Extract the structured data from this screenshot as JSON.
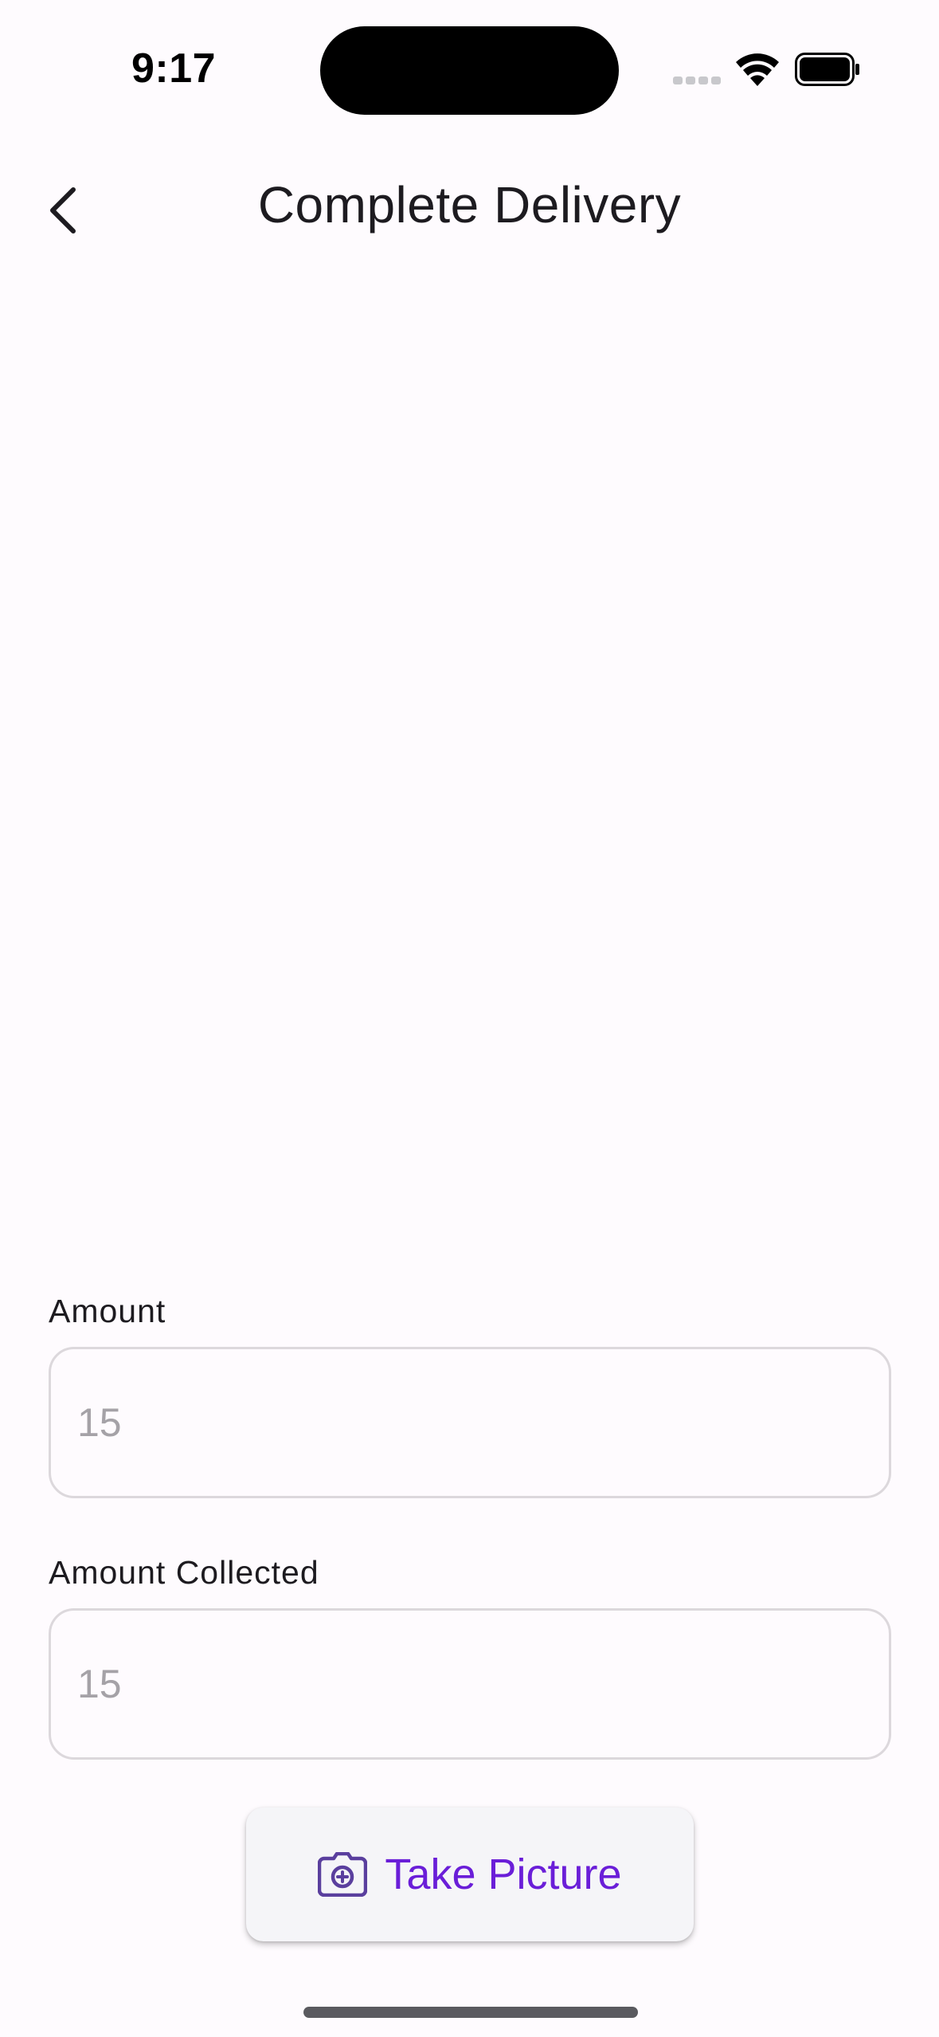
{
  "status_bar": {
    "time": "9:17",
    "icons": [
      "signal-dots-icon",
      "wifi-icon",
      "battery-icon"
    ]
  },
  "app_bar": {
    "title": "Complete Delivery",
    "back_icon": "chevron-left-icon"
  },
  "form": {
    "amount": {
      "label": "Amount",
      "value": "",
      "placeholder": "15"
    },
    "amount_collected": {
      "label": "Amount Collected",
      "value": "",
      "placeholder": "15"
    }
  },
  "actions": {
    "take_picture_label": "Take Picture",
    "take_picture_icon": "camera-icon"
  },
  "colors": {
    "background": "#fefbfe",
    "accent": "#6a1ed8",
    "icon_tint": "#5a3f9e",
    "input_border": "#dcd8dc",
    "placeholder": "#a5a2a7"
  }
}
